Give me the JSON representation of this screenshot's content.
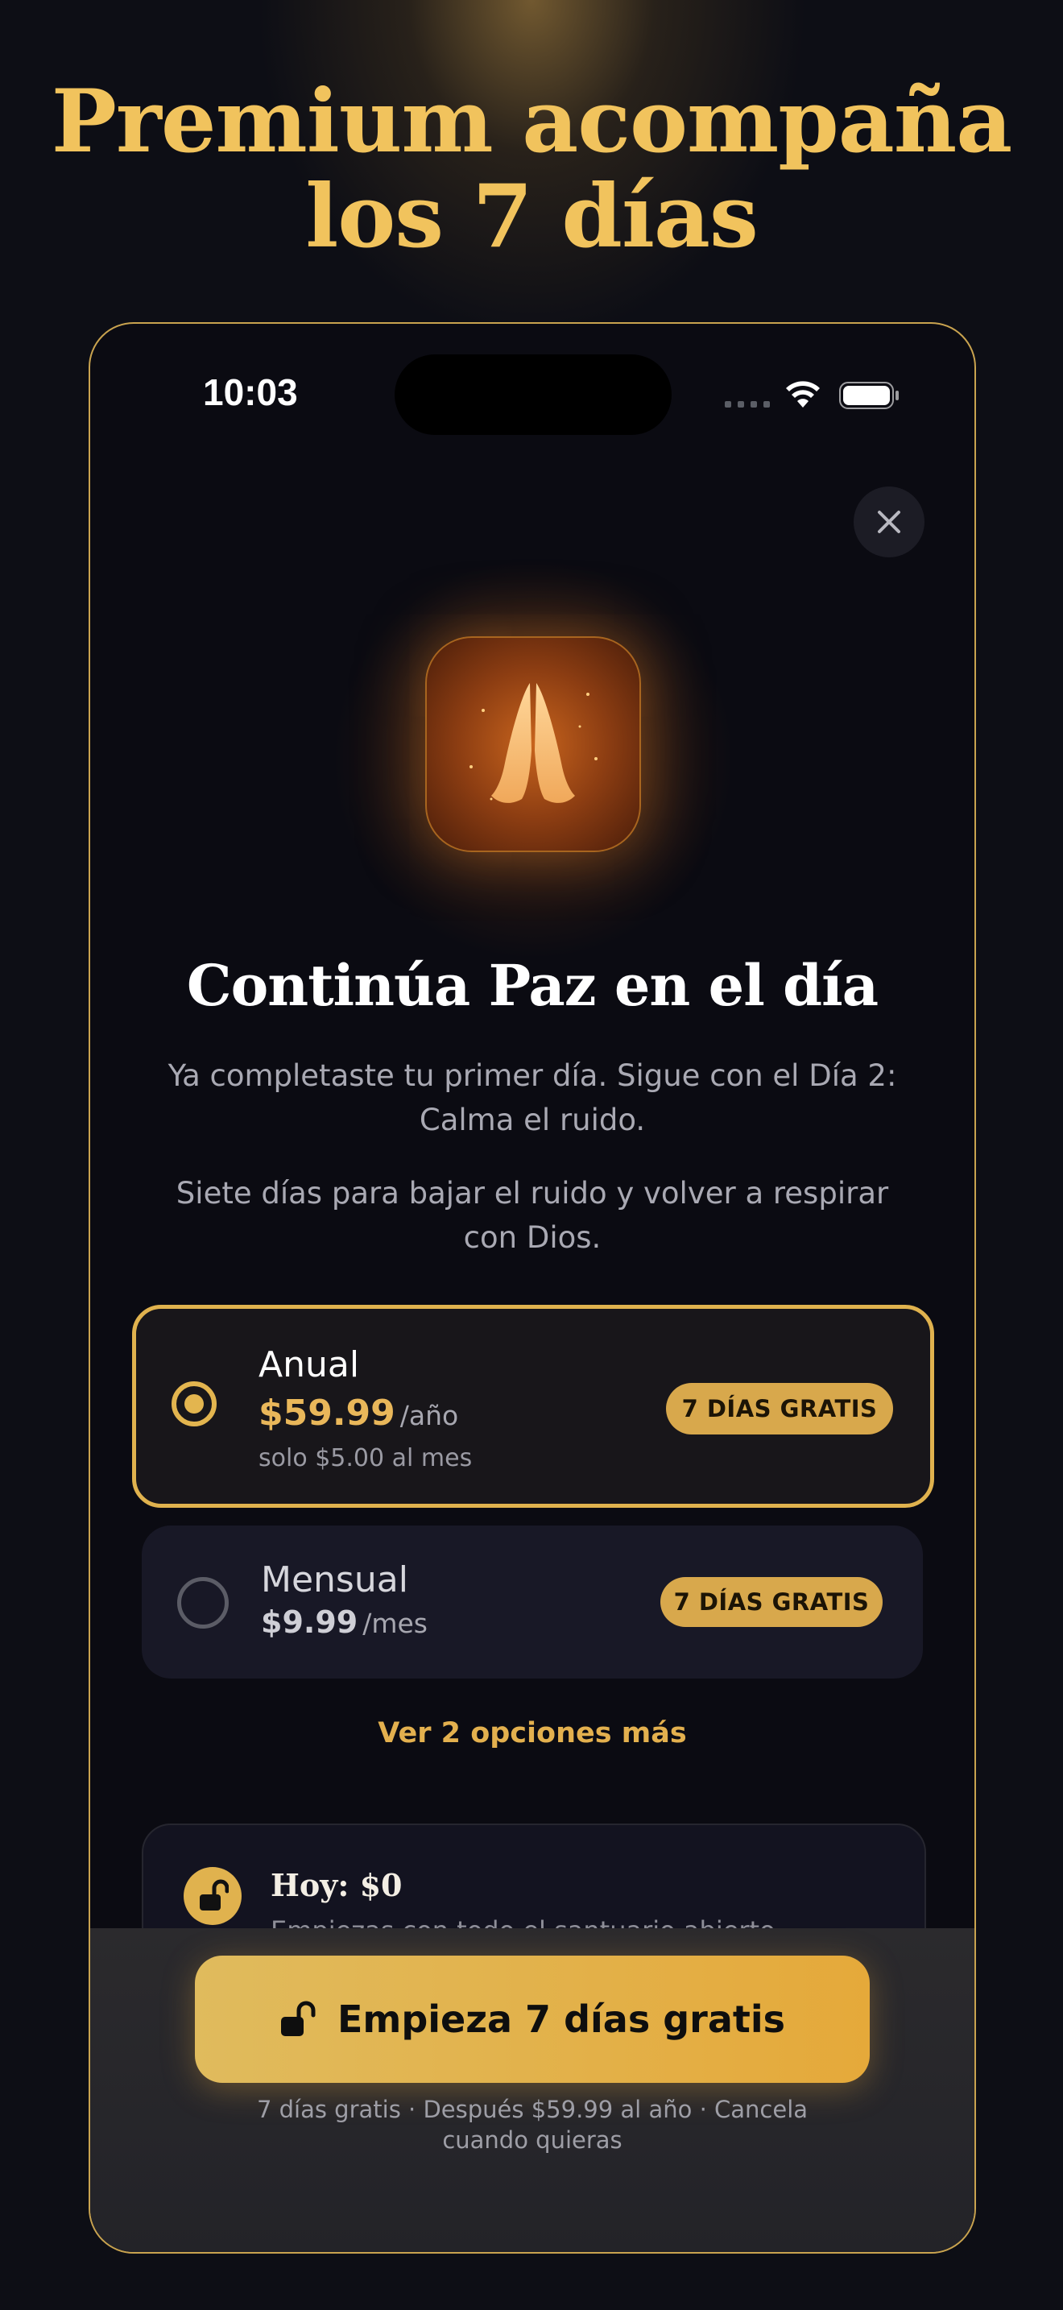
{
  "marketing": {
    "headline_line1": "Premium acompaña",
    "headline_line2": "los 7 días"
  },
  "status_bar": {
    "time": "10:03",
    "icons": [
      "signal-icon",
      "wifi-icon",
      "battery-icon"
    ]
  },
  "paywall": {
    "close_icon": "close-icon",
    "app_icon": "praying-hands-icon",
    "title": "Continúa Paz en el día",
    "paragraph1": "Ya completaste tu primer día. Sigue con el Día 2: Calma el ruido.",
    "paragraph2": "Siete días para bajar el ruido y volver a respirar con Dios.",
    "plans": [
      {
        "name": "Anual",
        "price": "$59.99",
        "period": "/año",
        "subprice": "solo $5.00 al mes",
        "badge": "7 DÍAS GRATIS",
        "selected": true
      },
      {
        "name": "Mensual",
        "price": "$9.99",
        "period": "/mes",
        "badge": "7 DÍAS GRATIS",
        "selected": false
      }
    ],
    "more_options": "Ver 2 opciones más",
    "timeline": {
      "icon": "unlock-icon",
      "title": "Hoy: $0",
      "subtitle": "Empiezas con todo el santuario abierto."
    },
    "cta": {
      "icon": "unlock-icon",
      "label": "Empieza 7 días gratis"
    },
    "fineprint": "7 días gratis · Después $59.99 al año · Cancela cuando quieras"
  },
  "colors": {
    "accent_gold": "#e3b54f",
    "background": "#0d0e15",
    "card": "#181826"
  }
}
